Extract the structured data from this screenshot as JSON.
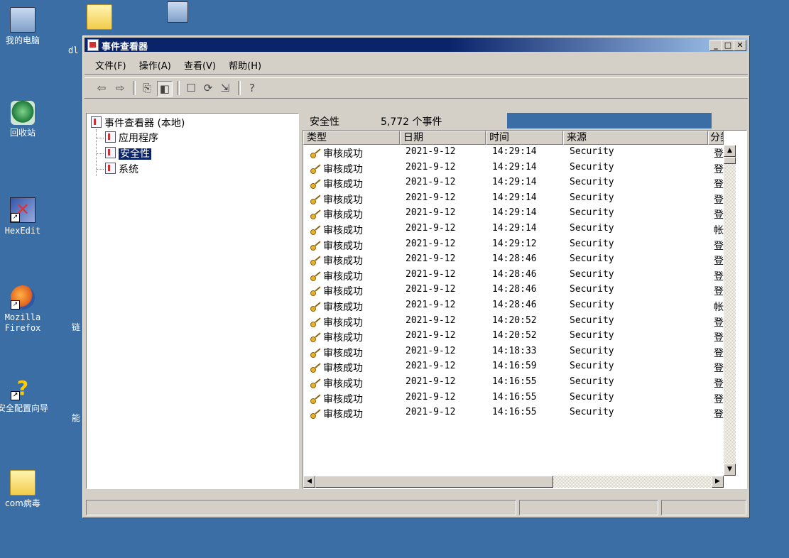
{
  "desktop": {
    "icons": [
      {
        "label": "我的电脑"
      },
      {
        "label": "回收站"
      },
      {
        "label": "HexEdit"
      },
      {
        "label": "Mozilla Firefox"
      },
      {
        "label": "安全配置向导"
      },
      {
        "label": "com病毒"
      }
    ],
    "partial_labels": [
      "dl",
      "链",
      "能"
    ]
  },
  "window": {
    "title": "事件查看器",
    "controls": {
      "minimize": "_",
      "maximize": "□",
      "close": "✕"
    },
    "menu": [
      "文件(F)",
      "操作(A)",
      "查看(V)",
      "帮助(H)"
    ],
    "toolbar_icons": [
      "back-arrow-icon",
      "forward-arrow-icon",
      "up-folder-icon",
      "show-hide-tree-icon",
      "properties-icon",
      "refresh-icon",
      "export-list-icon",
      "help-icon"
    ]
  },
  "tree": {
    "root": "事件查看器 (本地)",
    "items": [
      "应用程序",
      "安全性",
      "系统"
    ],
    "selected": "安全性"
  },
  "list": {
    "header_title": "安全性",
    "header_count": "5,772 个事件",
    "columns": [
      "类型",
      "日期",
      "时间",
      "来源",
      "分类"
    ],
    "rows": [
      {
        "type": "审核成功",
        "date": "2021-9-12",
        "time": "14:29:14",
        "source": "Security",
        "category": "登录"
      },
      {
        "type": "审核成功",
        "date": "2021-9-12",
        "time": "14:29:14",
        "source": "Security",
        "category": "登录"
      },
      {
        "type": "审核成功",
        "date": "2021-9-12",
        "time": "14:29:14",
        "source": "Security",
        "category": "登录"
      },
      {
        "type": "审核成功",
        "date": "2021-9-12",
        "time": "14:29:14",
        "source": "Security",
        "category": "登录"
      },
      {
        "type": "审核成功",
        "date": "2021-9-12",
        "time": "14:29:14",
        "source": "Security",
        "category": "登录"
      },
      {
        "type": "审核成功",
        "date": "2021-9-12",
        "time": "14:29:14",
        "source": "Security",
        "category": "帐户"
      },
      {
        "type": "审核成功",
        "date": "2021-9-12",
        "time": "14:29:12",
        "source": "Security",
        "category": "登录"
      },
      {
        "type": "审核成功",
        "date": "2021-9-12",
        "time": "14:28:46",
        "source": "Security",
        "category": "登录"
      },
      {
        "type": "审核成功",
        "date": "2021-9-12",
        "time": "14:28:46",
        "source": "Security",
        "category": "登录"
      },
      {
        "type": "审核成功",
        "date": "2021-9-12",
        "time": "14:28:46",
        "source": "Security",
        "category": "登录"
      },
      {
        "type": "审核成功",
        "date": "2021-9-12",
        "time": "14:28:46",
        "source": "Security",
        "category": "帐户"
      },
      {
        "type": "审核成功",
        "date": "2021-9-12",
        "time": "14:20:52",
        "source": "Security",
        "category": "登录"
      },
      {
        "type": "审核成功",
        "date": "2021-9-12",
        "time": "14:20:52",
        "source": "Security",
        "category": "登录"
      },
      {
        "type": "审核成功",
        "date": "2021-9-12",
        "time": "14:18:33",
        "source": "Security",
        "category": "登录"
      },
      {
        "type": "审核成功",
        "date": "2021-9-12",
        "time": "14:16:59",
        "source": "Security",
        "category": "登录"
      },
      {
        "type": "审核成功",
        "date": "2021-9-12",
        "time": "14:16:55",
        "source": "Security",
        "category": "登录"
      },
      {
        "type": "审核成功",
        "date": "2021-9-12",
        "time": "14:16:55",
        "source": "Security",
        "category": "登录"
      },
      {
        "type": "审核成功",
        "date": "2021-9-12",
        "time": "14:16:55",
        "source": "Security",
        "category": "登录"
      }
    ]
  },
  "colors": {
    "desktop": "#3a6ea5",
    "title_active": "#0a246a",
    "selection": "#0a246a",
    "chrome": "#d4d0c8"
  }
}
